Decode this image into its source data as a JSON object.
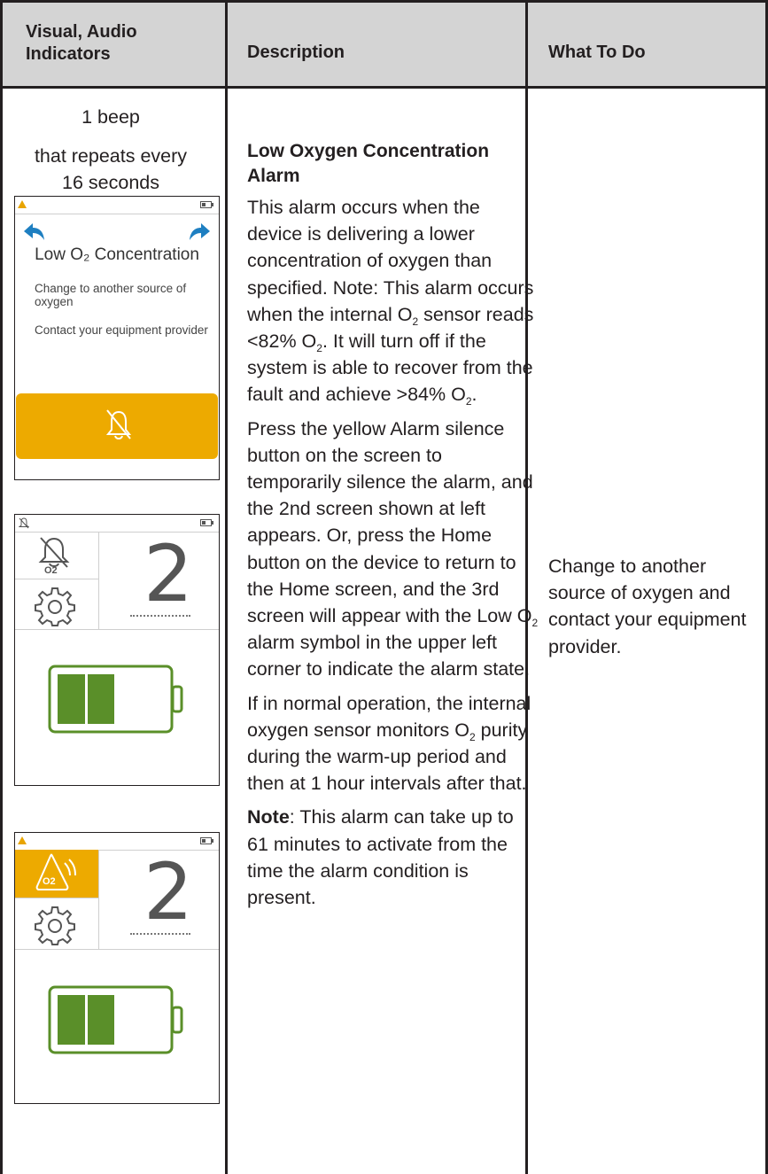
{
  "header": {
    "col1": "Visual, Audio Indicators",
    "col2": "Description",
    "col3": "What To Do"
  },
  "indicator": {
    "line1": "1 beep",
    "line2": "that repeats every",
    "line3": "16 seconds"
  },
  "screen1": {
    "title": "Low O₂ Concentration",
    "line1": "Change to another source of oxygen",
    "line2": "Contact your equipment provider"
  },
  "screen2": {
    "badge": "O2",
    "number": "2"
  },
  "screen3": {
    "badge": "O2",
    "number": "2"
  },
  "description": {
    "title": "Low Oxygen Concentration Alarm",
    "p1_a": "This alarm occurs when the device is delivering a lower concentration of oxygen than specified. Note: This alarm occurs when the internal O",
    "p1_b": " sensor reads <82% O",
    "p1_c": ". It will turn off if the system is able to recover from the fault and achieve >84% O",
    "p1_d": ".",
    "p2_a": "Press the yellow Alarm silence button on the screen to temporarily silence the alarm, and the 2nd screen shown at left appears. Or, press the Home button on the device to return to the Home screen, and the 3rd screen will appear with the Low O",
    "p2_b": " alarm symbol in the upper left corner to indicate the alarm state.",
    "p3_a": "If in normal operation, the internal oxygen sensor monitors O",
    "p3_b": " purity during the warm-up period and then at 1 hour intervals after that.",
    "p4_bold": "Note",
    "p4_rest": ": This alarm can take up to 61 minutes to activate from the time the alarm condition is present.",
    "sub2": "2"
  },
  "todo": {
    "text": "Change to another source of oxygen and contact your equipment provider."
  },
  "colors": {
    "header_bg": "#d4d4d4",
    "alarm_yellow": "#edaa00",
    "battery_green": "#5a8f29",
    "arrow_blue": "#1e7fc1"
  }
}
